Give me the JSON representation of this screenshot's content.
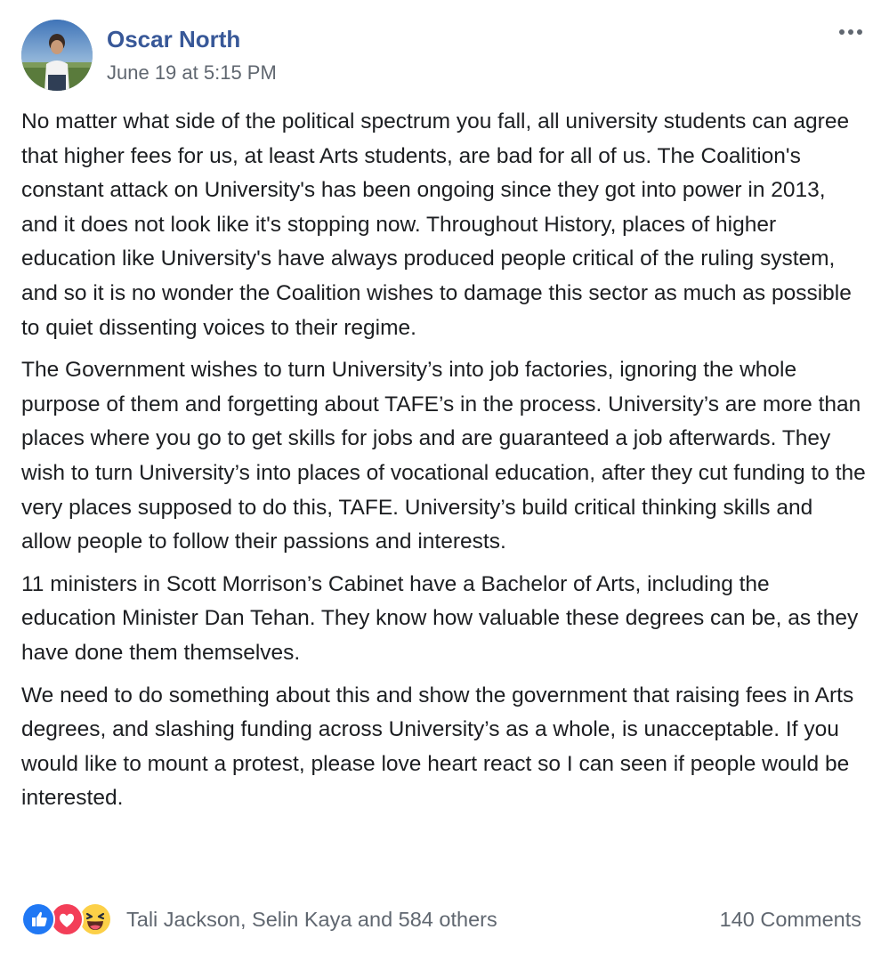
{
  "post": {
    "author": "Oscar North",
    "timestamp": "June 19 at 5:15 PM",
    "paragraphs": [
      "No matter what side of the political spectrum you fall, all university students can agree that higher fees for us, at least Arts students, are bad for all of us. The Coalition's constant attack on University's has been ongoing since they got into power in 2013, and it does not look like it's stopping now. Throughout History, places of higher education like University's have always produced people critical of the ruling system, and so it is no wonder the Coalition wishes to damage this sector as much as possible to quiet dissenting voices to their regime.",
      "The Government wishes to turn University’s into job factories, ignoring the whole purpose of them and forgetting about TAFE’s in the process. University’s are more than places where you go to get skills for jobs and are guaranteed a job afterwards. They wish to turn University’s into places of vocational education, after they cut funding to the very places supposed to do this, TAFE. University’s build critical thinking skills and allow people to follow their passions and interests.",
      "11 ministers in Scott Morrison’s Cabinet have a Bachelor of Arts, including the education Minister Dan Tehan. They know how valuable these degrees can be, as they have done them themselves.",
      "We need to do something about this and show the government that raising fees in Arts degrees, and slashing funding across University’s as a whole, is unacceptable. If you would like to mount a protest, please love heart react so I can seen if people would be interested."
    ]
  },
  "footer": {
    "reactions": [
      "like-icon",
      "love-icon",
      "haha-icon"
    ],
    "reaction_names": "Tali Jackson, Selin Kaya and 584 others",
    "comments": "140 Comments"
  },
  "colors": {
    "author_link": "#385898",
    "secondary_text": "#606770",
    "like_blue": "#2078f4",
    "love_red": "#f33e58",
    "haha_yellow": "#fcd048"
  }
}
